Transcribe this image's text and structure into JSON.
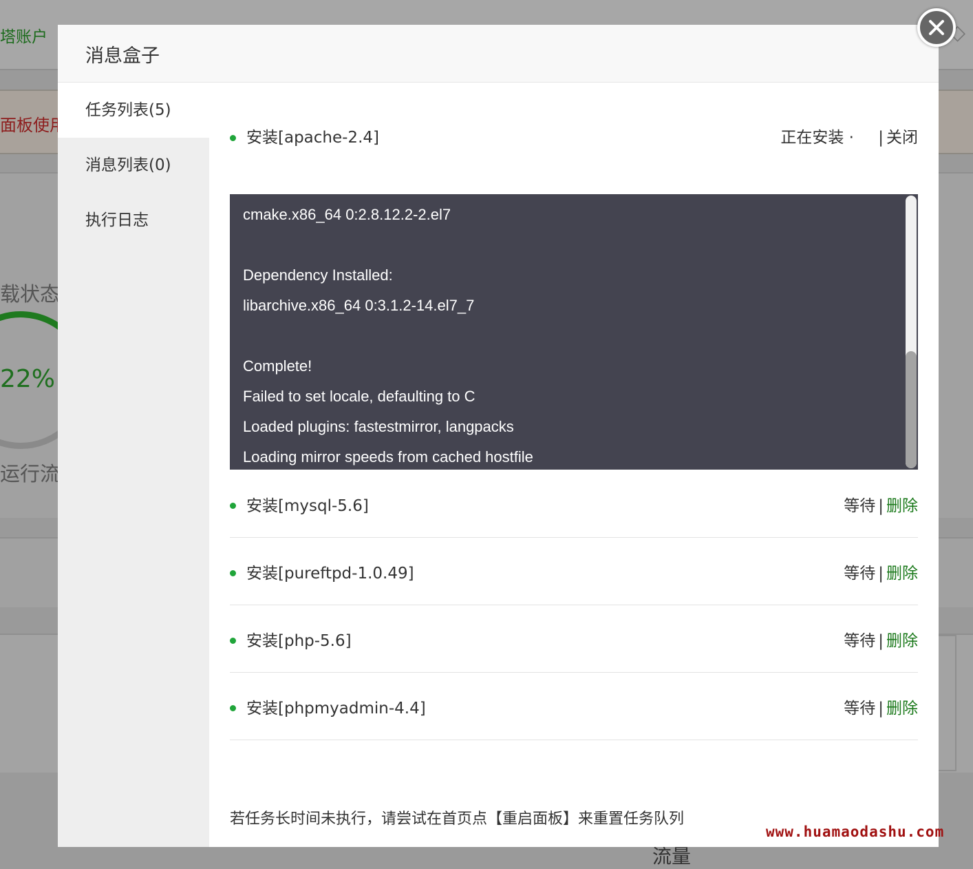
{
  "background": {
    "account_label": "塔账户",
    "alert_text": "面板使用",
    "status_title": "载状态",
    "gauge_percent": "22%",
    "gauge_value": 0.22,
    "run_label": "运行流畅",
    "traffic_label": "流量"
  },
  "modal": {
    "title": "消息盒子",
    "sidebar": [
      {
        "label": "任务列表(5)",
        "active": true
      },
      {
        "label": "消息列表(0)",
        "active": false
      },
      {
        "label": "执行日志",
        "active": false
      }
    ],
    "current_task": {
      "name": "安装[apache-2.4]",
      "status": "正在安装 ·",
      "separator": "|",
      "close_label": "关闭"
    },
    "console_lines": [
      "cmake.x86_64 0:2.8.12.2-2.el7",
      "",
      "Dependency Installed:",
      "libarchive.x86_64 0:3.1.2-14.el7_7",
      "",
      "Complete!",
      "Failed to set locale, defaulting to C",
      "Loaded plugins: fastestmirror, langpacks",
      "Loading mirror speeds from cached hostfile"
    ],
    "queued_tasks": [
      {
        "name": "安装[mysql-5.6]",
        "status": "等待",
        "separator": "|",
        "delete_label": "删除"
      },
      {
        "name": "安装[pureftpd-1.0.49]",
        "status": "等待",
        "separator": "|",
        "delete_label": "删除"
      },
      {
        "name": "安装[php-5.6]",
        "status": "等待",
        "separator": "|",
        "delete_label": "删除"
      },
      {
        "name": "安装[phpmyadmin-4.4]",
        "status": "等待",
        "separator": "|",
        "delete_label": "删除"
      }
    ],
    "hint": "若任务长时间未执行，请尝试在首页点【重启面板】来重置任务队列"
  },
  "watermark": "www.huamaodashu.com",
  "colors": {
    "accent_green": "#20a53a",
    "delete_link": "#1c7a1c",
    "console_bg": "#444450"
  }
}
